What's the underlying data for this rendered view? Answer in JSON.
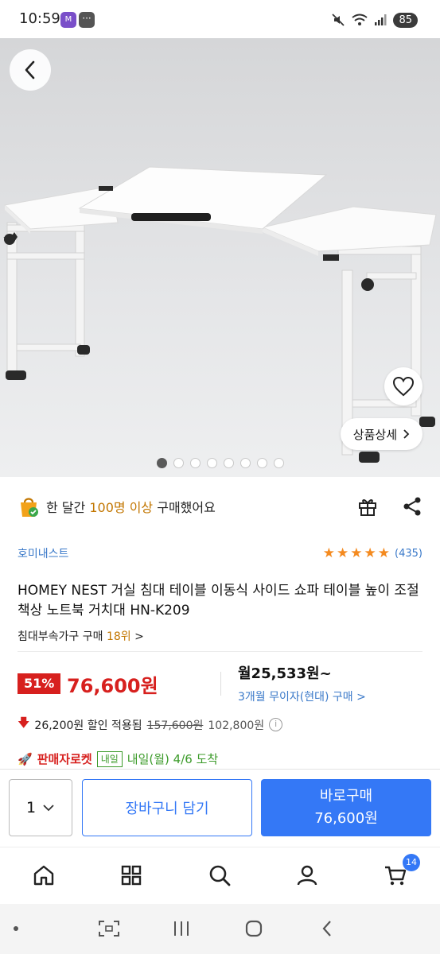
{
  "status_bar": {
    "time": "10:59",
    "battery": "85",
    "app_icons": [
      "M",
      "···"
    ]
  },
  "hero": {
    "detail_label": "상품상세",
    "slide_count": 8,
    "active_slide": 1
  },
  "social": {
    "prefix": "한 달간 ",
    "highlight": "100명 이상",
    "suffix": " 구매했어요"
  },
  "brand": {
    "name": "호미내스트",
    "rating_count": "(435)",
    "rating_stars": 5
  },
  "product": {
    "title": "HOMEY NEST 거실 침대 테이블 이동식 사이드 쇼파 테이블 높이 조절 책상 노트북 거치대 HN-K209",
    "rank_category": "침대부속가구 구매 ",
    "rank_value": "18위",
    "rank_chevron": ">"
  },
  "price": {
    "discount_rate": "51%",
    "sale_price": "76,600원",
    "monthly": "월25,533원~",
    "installment": "3개월 무이자(현대) 구매 >",
    "discount_amount": "26,200원 할인 적용됨",
    "original_strike": "157,600원",
    "original_price": "102,800원"
  },
  "delivery": {
    "rocket_label": "판매자로켓",
    "badge": "내일",
    "arrival": "내일(월) 4/6 도착"
  },
  "actions": {
    "quantity": "1",
    "cart_label": "장바구니 담기",
    "buy_label": "바로구매",
    "buy_price": "76,600원"
  },
  "nav": {
    "cart_count": "14"
  },
  "colors": {
    "accent_blue": "#3478f6",
    "sale_red": "#d7201e",
    "link_blue": "#3a79c9",
    "rank_orange": "#c27600",
    "delivery_green": "#3c9b2a"
  }
}
